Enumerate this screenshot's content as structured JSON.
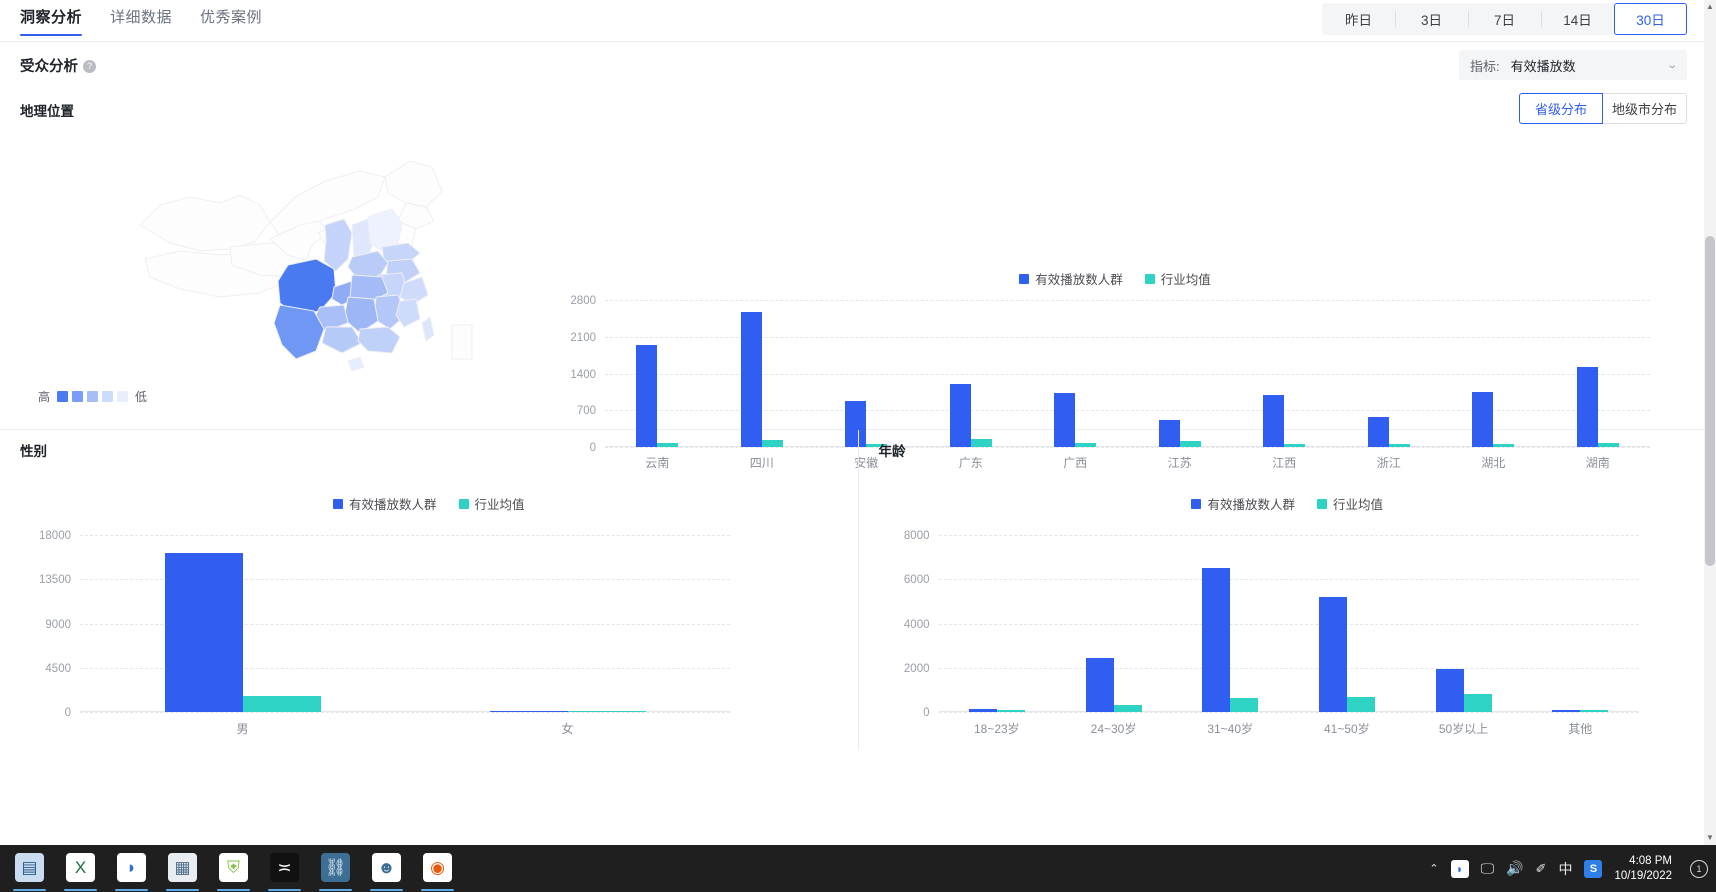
{
  "tabs": [
    {
      "label": "洞察分析",
      "active": true
    },
    {
      "label": "详细数据",
      "active": false
    },
    {
      "label": "优秀案例",
      "active": false
    }
  ],
  "date_ranges": [
    {
      "label": "昨日",
      "active": false
    },
    {
      "label": "3日",
      "active": false
    },
    {
      "label": "7日",
      "active": false
    },
    {
      "label": "14日",
      "active": false
    },
    {
      "label": "30日",
      "active": true
    }
  ],
  "section": {
    "title": "受众分析",
    "help_icon": "question-mark-icon"
  },
  "metric_select": {
    "label": "指标:",
    "value": "有效播放数",
    "caret_icon": "chevron-down-icon"
  },
  "geo": {
    "subtitle": "地理位置",
    "toggle": [
      {
        "label": "省级分布",
        "active": true
      },
      {
        "label": "地级市分布",
        "active": false
      }
    ],
    "legend_high": "高",
    "legend_low": "低",
    "legend_swatches": [
      "#4a7af2",
      "#7b9df5",
      "#a7bdf8",
      "#cfdbfb",
      "#e8eefd"
    ]
  },
  "colors": {
    "series1": "#2f5ef0",
    "series2": "#2fd3c4",
    "accent": "#2f5ef0",
    "grid": "#e4e6ea",
    "axis_text": "#9aa0a8"
  },
  "chart_data": [
    {
      "type": "bar",
      "id": "province-chart",
      "title": "",
      "categories": [
        "云南",
        "四川",
        "安徽",
        "广东",
        "广西",
        "江苏",
        "江西",
        "浙江",
        "湖北",
        "湖南"
      ],
      "series": [
        {
          "name": "有效播放数人群",
          "color": "#2f5ef0",
          "values": [
            1950,
            2580,
            880,
            1200,
            1030,
            520,
            1000,
            580,
            1040,
            1520
          ]
        },
        {
          "name": "行业均值",
          "color": "#2fd3c4",
          "values": [
            70,
            140,
            60,
            150,
            70,
            110,
            55,
            60,
            55,
            75
          ]
        }
      ],
      "yticks": [
        0,
        700,
        1400,
        2100,
        2800
      ],
      "ylim": [
        0,
        2800
      ],
      "grid": true,
      "legend_position": "top-center"
    },
    {
      "type": "bar",
      "id": "gender-chart",
      "title": "性别",
      "categories": [
        "男",
        "女"
      ],
      "series": [
        {
          "name": "有效播放数人群",
          "color": "#2f5ef0",
          "values": [
            16200,
            90
          ]
        },
        {
          "name": "行业均值",
          "color": "#2fd3c4",
          "values": [
            1600,
            70
          ]
        }
      ],
      "yticks": [
        0,
        4500,
        9000,
        13500,
        18000
      ],
      "ylim": [
        0,
        18000
      ],
      "grid": true,
      "legend_position": "top-center"
    },
    {
      "type": "bar",
      "id": "age-chart",
      "title": "年龄",
      "categories": [
        "18~23岁",
        "24~30岁",
        "31~40岁",
        "41~50岁",
        "50岁以上",
        "其他"
      ],
      "series": [
        {
          "name": "有效播放数人群",
          "color": "#2f5ef0",
          "values": [
            120,
            2450,
            6500,
            5200,
            1950,
            90
          ]
        },
        {
          "name": "行业均值",
          "color": "#2fd3c4",
          "values": [
            80,
            300,
            620,
            700,
            830,
            70
          ]
        }
      ],
      "yticks": [
        0,
        2000,
        4000,
        6000,
        8000
      ],
      "ylim": [
        0,
        8000
      ],
      "grid": true,
      "legend_position": "top-center"
    }
  ],
  "scrollbar": {
    "up_arrow": "chevron-up-icon",
    "down_arrow": "chevron-down-icon"
  },
  "taskbar": {
    "items": [
      {
        "name": "sticky-notes",
        "glyph": "▤",
        "bg": "#c9dcf0",
        "fg": "#2a5b8c"
      },
      {
        "name": "excel",
        "glyph": "X",
        "bg": "#ffffff",
        "fg": "#1d7044"
      },
      {
        "name": "qq-browser",
        "glyph": "◗",
        "bg": "#ffffff",
        "fg": "#2f6fd0"
      },
      {
        "name": "calculator",
        "glyph": "▦",
        "bg": "#e9edf2",
        "fg": "#4d6b8a"
      },
      {
        "name": "security-shield",
        "glyph": "⛨",
        "bg": "#ffffff",
        "fg": "#7fbc42"
      },
      {
        "name": "capcut",
        "glyph": "≍",
        "bg": "#111111",
        "fg": "#ffffff"
      },
      {
        "name": "link-tool",
        "glyph": "⛓",
        "bg": "#3d6e94",
        "fg": "#e7f1f8"
      },
      {
        "name": "user-profile",
        "glyph": "☻",
        "bg": "#ffffff",
        "fg": "#3d6e94"
      },
      {
        "name": "firefox",
        "glyph": "◉",
        "bg": "#ffffff",
        "fg": "#e8590c"
      }
    ],
    "tray": [
      {
        "name": "show-hidden-icons",
        "glyph": "⌃"
      },
      {
        "name": "input-method-qq",
        "glyph": "◗"
      },
      {
        "name": "network",
        "glyph": "🖳"
      },
      {
        "name": "volume",
        "glyph": "🔊"
      },
      {
        "name": "pen",
        "glyph": "✎"
      },
      {
        "name": "ime-chinese",
        "glyph": "中"
      },
      {
        "name": "sogou-input",
        "glyph": "S"
      }
    ],
    "clock": {
      "time": "4:08 PM",
      "date": "10/19/2022"
    },
    "notification_count": "1"
  }
}
